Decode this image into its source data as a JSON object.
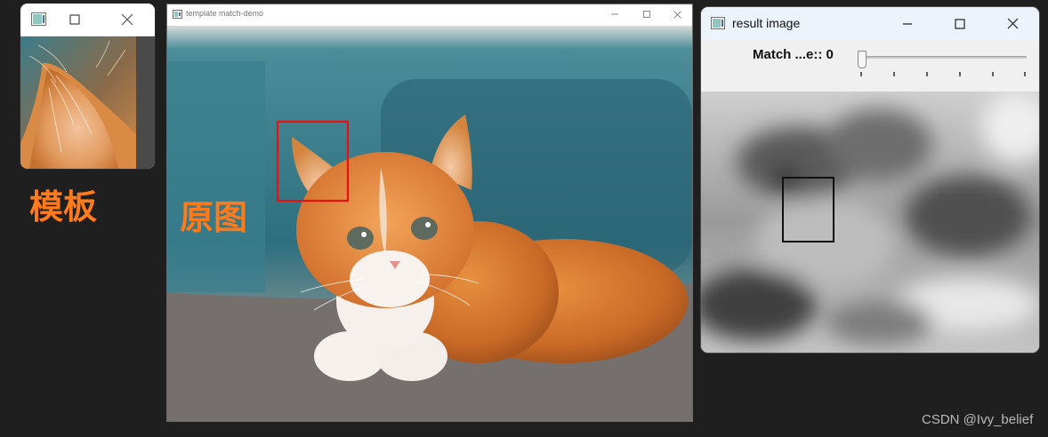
{
  "windows": {
    "template": {
      "title": "",
      "image": "cat-ear-template"
    },
    "main": {
      "title": "template match-demo",
      "image": "kitten-photo",
      "match_box_color": "#e81010"
    },
    "result": {
      "title": "result image",
      "trackbar_label": "Match ...e:: 0",
      "trackbar_value": 0,
      "trackbar_ticks": 6,
      "match_box_color": "#111111"
    }
  },
  "annotations": {
    "template_label": "模板",
    "source_label": "原图",
    "label_color": "#ff7a1a"
  },
  "watermark": "CSDN @Ivy_belief"
}
